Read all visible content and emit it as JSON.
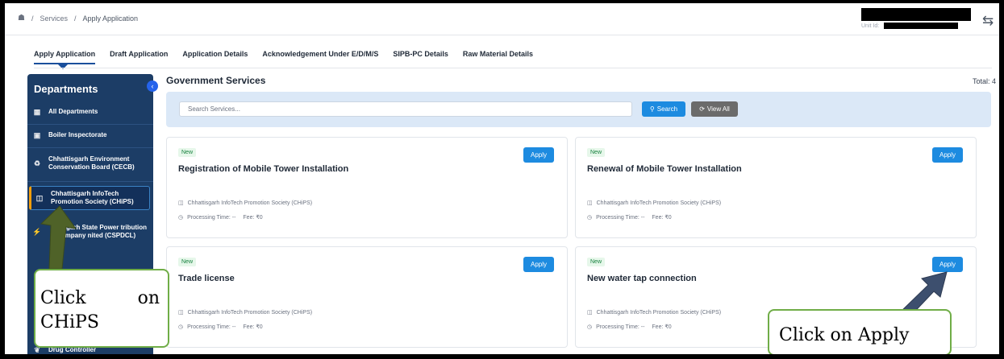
{
  "breadcrumb": {
    "level1": "Services",
    "level2": "Apply Application"
  },
  "header": {
    "unit_label": "Unit Id:"
  },
  "tabs": [
    {
      "label": "Apply Application",
      "active": true
    },
    {
      "label": "Draft Application",
      "active": false
    },
    {
      "label": "Application Details",
      "active": false
    },
    {
      "label": "Acknowledgement Under E/D/M/S",
      "active": false
    },
    {
      "label": "SIPB-PC Details",
      "active": false
    },
    {
      "label": "Raw Material Details",
      "active": false
    }
  ],
  "sidebar": {
    "title": "Departments",
    "items": [
      {
        "label": "All Departments",
        "icon": "grid-icon"
      },
      {
        "label": "Boiler Inspectorate",
        "icon": "building-icon"
      },
      {
        "label": "Chhattisgarh Environment Conservation Board (CECB)",
        "icon": "recycle-icon"
      },
      {
        "label": "Chhattisgarh InfoTech Promotion Society (CHiPS)",
        "icon": "chip-icon",
        "selected": true
      },
      {
        "label": "ttisgarh State Power tribution Company nited (CSPDCL)",
        "icon": "power-icon"
      },
      {
        "label": "Drug Controller",
        "icon": "drug-icon"
      }
    ]
  },
  "main": {
    "title": "Government Services",
    "total": "Total: 4",
    "search_placeholder": "Search Services...",
    "search_label": "Search",
    "viewall_label": "View All"
  },
  "cards": [
    {
      "badge": "New",
      "title": "Registration of Mobile Tower Installation",
      "apply": "Apply",
      "dept": "Chhattisgarh InfoTech Promotion Society (CHiPS)",
      "processing": "Processing Time: --",
      "fee": "Fee: ₹0"
    },
    {
      "badge": "New",
      "title": "Renewal of Mobile Tower Installation",
      "apply": "Apply",
      "dept": "Chhattisgarh InfoTech Promotion Society (CHiPS)",
      "processing": "Processing Time: --",
      "fee": "Fee: ₹0"
    },
    {
      "badge": "New",
      "title": "Trade license",
      "apply": "Apply",
      "dept": "Chhattisgarh InfoTech Promotion Society (CHiPS)",
      "processing": "Processing Time: --",
      "fee": "Fee: ₹0"
    },
    {
      "badge": "New",
      "title": "New water tap connection",
      "apply": "Apply",
      "dept": "Chhattisgarh InfoTech Promotion Society (CHiPS)",
      "processing": "Processing Time: --",
      "fee": "Fee: ₹0"
    }
  ],
  "annotations": {
    "callout1_word1": "Click",
    "callout1_word2": "on",
    "callout1_line2": "CHiPS",
    "callout2": "Click on Apply"
  },
  "colors": {
    "sidebar": "#1c3d66",
    "accent": "#1d8be0",
    "callout_border": "#70ad47",
    "arrow": "#4f6228"
  }
}
